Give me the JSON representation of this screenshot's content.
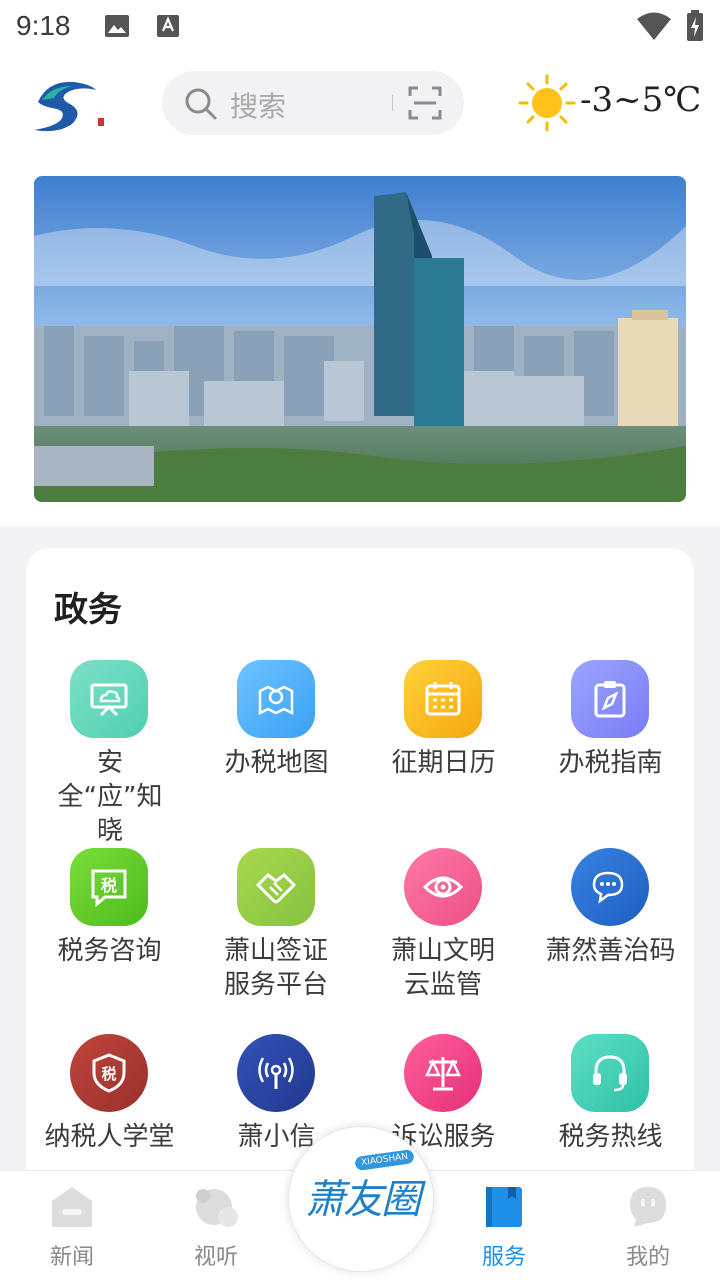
{
  "status_bar": {
    "time": "9:18"
  },
  "header": {
    "search_placeholder": "搜索",
    "weather": "-3~5℃"
  },
  "section": {
    "title": "政务",
    "items": [
      {
        "label": "安全“应”知晓",
        "icon": "monitor-cloud-icon",
        "color": [
          "#7ee0c6",
          "#4fd0b0"
        ]
      },
      {
        "label": "办税地图",
        "icon": "map-pin-icon",
        "color": [
          "#6fc4ff",
          "#3aa0f5"
        ]
      },
      {
        "label": "征期日历",
        "icon": "calendar-icon",
        "color": [
          "#ffd23a",
          "#f5a70f"
        ]
      },
      {
        "label": "办税指南",
        "icon": "compass-clipboard-icon",
        "color": [
          "#9aa5ff",
          "#7a7cf5"
        ]
      },
      {
        "label": "税务咨询",
        "icon": "tax-chat-icon",
        "color": [
          "#7bdc3a",
          "#4cbc1c"
        ]
      },
      {
        "label": "萧山签证服务平台",
        "icon": "handshake-icon",
        "color": [
          "#a8d84c",
          "#86c240"
        ]
      },
      {
        "label": "萧山文明云监管",
        "icon": "eye-icon",
        "color": [
          "#ff7aa8",
          "#ec4f86"
        ]
      },
      {
        "label": "萧然善治码",
        "icon": "chat-bubbles-icon",
        "color": [
          "#3a82e2",
          "#1d5fc0"
        ]
      },
      {
        "label": "纳税人学堂",
        "icon": "tax-shield-icon",
        "color": [
          "#c0453c",
          "#98302b"
        ]
      },
      {
        "label": "萧小信",
        "icon": "signal-pin-icon",
        "color": [
          "#3153b8",
          "#22388f"
        ]
      },
      {
        "label": "诉讼服务",
        "icon": "scales-icon",
        "color": [
          "#ff5f9c",
          "#e52f76"
        ]
      },
      {
        "label": "税务热线",
        "icon": "headset-icon",
        "color": [
          "#5ee0c4",
          "#2fc0a8"
        ]
      }
    ]
  },
  "bottom_nav": {
    "items": [
      {
        "label": "新闻",
        "icon": "news-house-icon"
      },
      {
        "label": "视听",
        "icon": "media-circles-icon"
      },
      {
        "label": "服务",
        "icon": "book-icon",
        "active": true
      },
      {
        "label": "我的",
        "icon": "profile-face-icon"
      }
    ],
    "center_badge": {
      "text": "萧友圈",
      "sub": "XIAOSHAN"
    }
  },
  "colors": {
    "accent": "#1f8ee6",
    "inactive": "#8a8a8a",
    "background": "#f3f3f5"
  }
}
